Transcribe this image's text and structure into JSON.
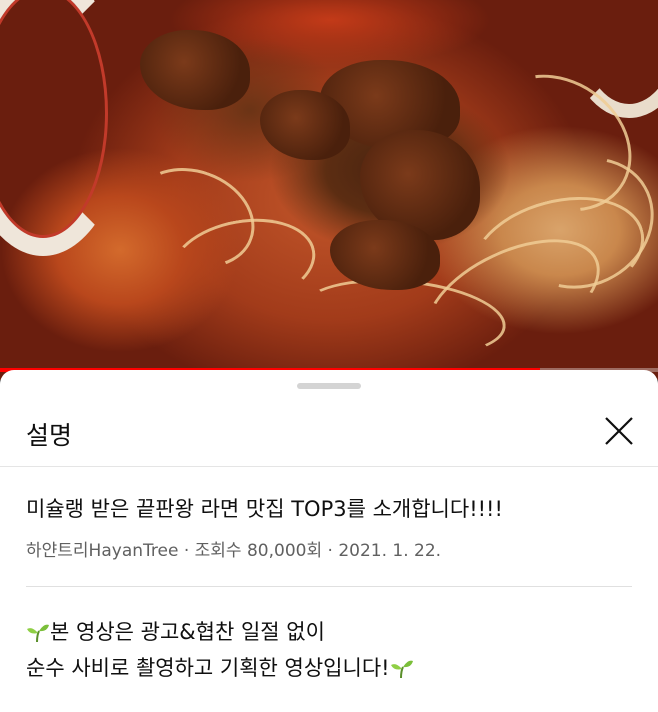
{
  "video": {
    "image_description_icon": "ramen-bowl-thumbnail",
    "progress_fraction": 0.82,
    "progress_color": "#ff0000"
  },
  "sheet": {
    "title": "설명",
    "close_icon": "close-icon",
    "video_title": "미슐랭 받은 끝판왕 라면 맛집 TOP3를 소개합니다!!!!",
    "channel": "하얀트리HayanTree",
    "separator": "·",
    "views": "조회수 80,000회",
    "date": "2021. 1. 22.",
    "description_lines": [
      "본 영상은 광고&협찬 일절 없이",
      "순수 사비로 촬영하고 기획한 영상입니다!"
    ],
    "sprout_icon": "sprout-emoji-icon"
  }
}
